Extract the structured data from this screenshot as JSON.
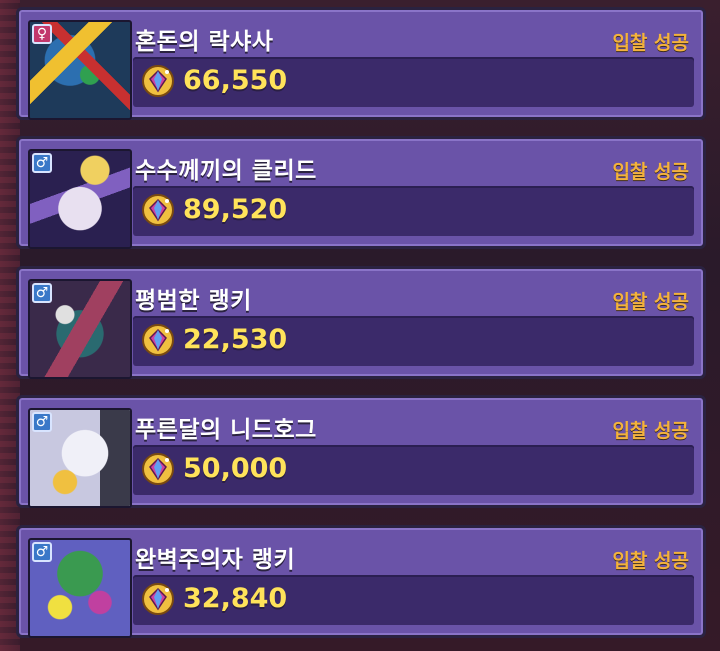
{
  "items": [
    {
      "gender": "female",
      "gender_symbol": "♀",
      "name": "혼돈의 락샤사",
      "status": "입찰 성공",
      "price": "66,550",
      "portrait_colors": [
        "#2c6fb0",
        "#f0c030",
        "#c83030",
        "#30a050"
      ]
    },
    {
      "gender": "male",
      "gender_symbol": "♂",
      "name": "수수께끼의 클리드",
      "status": "입찰 성공",
      "price": "89,520",
      "portrait_colors": [
        "#e8e0f0",
        "#b0a0e0",
        "#f0d060",
        "#8060c0"
      ]
    },
    {
      "gender": "male",
      "gender_symbol": "♂",
      "name": "평범한 랭키",
      "status": "입찰 성공",
      "price": "22,530",
      "portrait_colors": [
        "#2a6a70",
        "#5a3a6a",
        "#a04060",
        "#e0e0e0"
      ]
    },
    {
      "gender": "male",
      "gender_symbol": "♂",
      "name": "푸른달의 니드호그",
      "status": "입찰 성공",
      "price": "50,000",
      "portrait_colors": [
        "#f0f0f8",
        "#c8c8e0",
        "#f0c040",
        "#3060b0"
      ]
    },
    {
      "gender": "male",
      "gender_symbol": "♂",
      "name": "완벽주의자 랭키",
      "status": "입찰 성공",
      "price": "32,840",
      "portrait_colors": [
        "#3a9a50",
        "#6060c0",
        "#f0e040",
        "#c040a0"
      ]
    }
  ],
  "icons": {
    "currency": "gem-coin-icon"
  },
  "colors": {
    "status": "#f4b23c",
    "price": "#ffe35a",
    "card": "#6a53a8",
    "price_box": "#3b2a6a"
  }
}
